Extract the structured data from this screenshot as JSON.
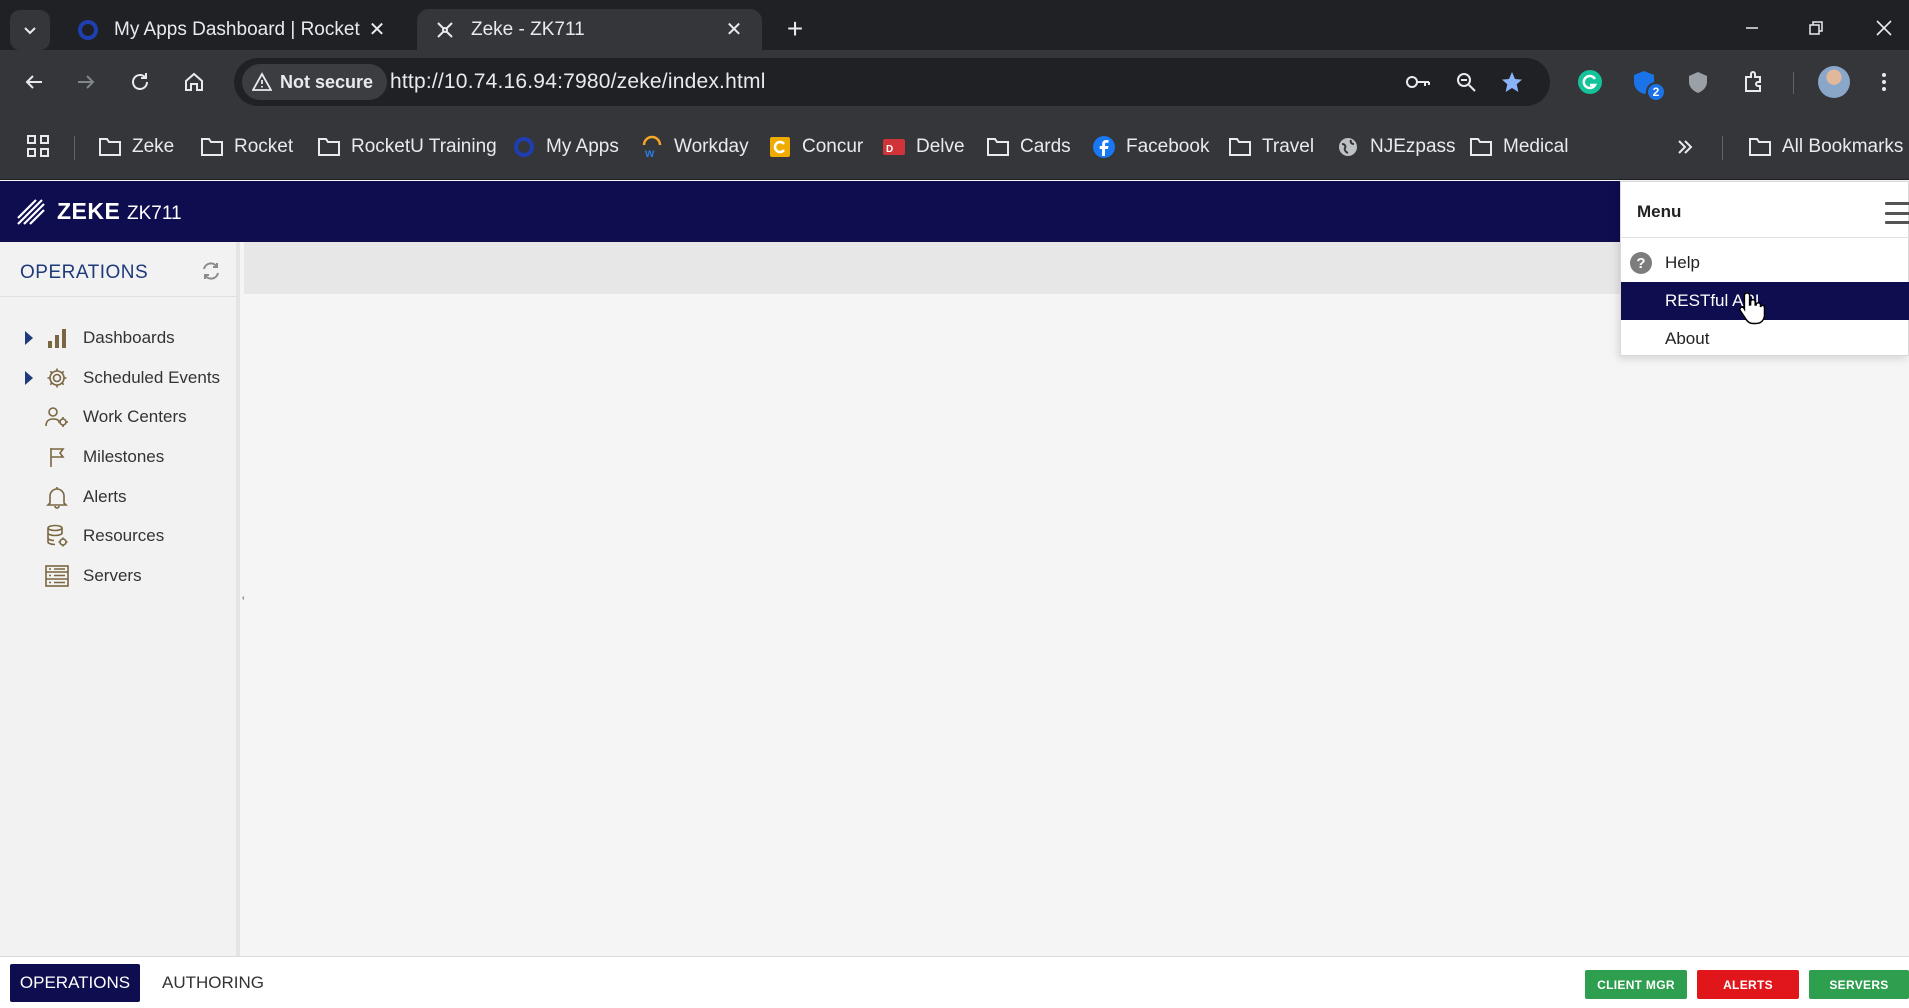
{
  "browser": {
    "tabs": [
      {
        "title": "My Apps Dashboard | Rocket Sc",
        "active": false
      },
      {
        "title": "Zeke - ZK711",
        "active": true
      }
    ],
    "address": {
      "security_label": "Not secure",
      "url": "http://10.74.16.94:7980/zeke/index.html"
    },
    "extension_badge": "2",
    "bookmarks": [
      {
        "label": "Zeke",
        "icon": "folder-icon"
      },
      {
        "label": "Rocket",
        "icon": "folder-icon"
      },
      {
        "label": "RocketU Training",
        "icon": "folder-icon"
      },
      {
        "label": "My Apps",
        "icon": "okta-icon"
      },
      {
        "label": "Workday",
        "icon": "workday-icon"
      },
      {
        "label": "Concur",
        "icon": "concur-icon"
      },
      {
        "label": "Delve",
        "icon": "delve-icon"
      },
      {
        "label": "Cards",
        "icon": "folder-icon"
      },
      {
        "label": "Facebook",
        "icon": "facebook-icon"
      },
      {
        "label": "Travel",
        "icon": "folder-icon"
      },
      {
        "label": "NJEzpass",
        "icon": "globe-icon"
      },
      {
        "label": "Medical",
        "icon": "folder-icon"
      }
    ],
    "all_bookmarks": "All Bookmarks"
  },
  "app": {
    "brand": "ZEKE",
    "instance": "ZK711",
    "sidebar": {
      "title": "OPERATIONS",
      "items": [
        {
          "label": "Dashboards",
          "icon": "bar-chart-icon",
          "expandable": true
        },
        {
          "label": "Scheduled Events",
          "icon": "gear-icon",
          "expandable": true
        },
        {
          "label": "Work Centers",
          "icon": "people-gear-icon",
          "expandable": false
        },
        {
          "label": "Milestones",
          "icon": "flag-icon",
          "expandable": false
        },
        {
          "label": "Alerts",
          "icon": "bell-icon",
          "expandable": false
        },
        {
          "label": "Resources",
          "icon": "database-icon",
          "expandable": false
        },
        {
          "label": "Servers",
          "icon": "server-list-icon",
          "expandable": false
        }
      ]
    },
    "menu": {
      "title": "Menu",
      "items": [
        {
          "label": "Help",
          "icon": "help-circle-icon",
          "selected": false
        },
        {
          "label": "RESTful API",
          "icon": "",
          "selected": true
        },
        {
          "label": "About",
          "icon": "",
          "selected": false
        }
      ]
    },
    "footer": {
      "tabs": [
        {
          "label": "OPERATIONS",
          "active": true
        },
        {
          "label": "AUTHORING",
          "active": false
        }
      ],
      "status_buttons": [
        {
          "label": "CLIENT MGR",
          "color": "#2e9e4f"
        },
        {
          "label": "ALERTS",
          "color": "#e0161b"
        },
        {
          "label": "SERVERS",
          "color": "#2e9e4f"
        }
      ]
    }
  },
  "colors": {
    "header_navy": "#0e0d4f",
    "sidebar_title_blue": "#1e3a7b",
    "icon_brown": "#7a6640",
    "chrome_dark": "#202124",
    "chrome_toolbar": "#35363a"
  }
}
